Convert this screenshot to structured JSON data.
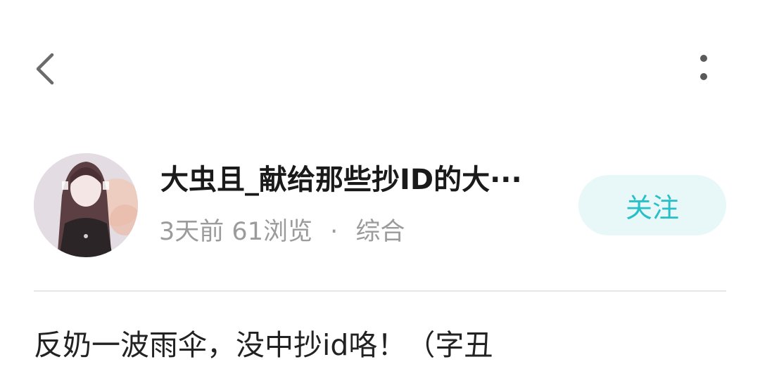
{
  "header": {
    "back_icon": "chevron-left-icon",
    "more_icon": "more-vertical-icon"
  },
  "post": {
    "author_title": "大虫且_献给那些抄ID的大···",
    "time": "3天前",
    "views": "61浏览",
    "separator": "·",
    "category": "综合",
    "follow_label": "关注",
    "body": "反奶一波雨伞，没中抄id咯！（字丑"
  },
  "colors": {
    "accent": "#28c0c8",
    "follow_bg": "#e8f7f7",
    "meta": "#9b9b9b",
    "divider": "#e6e6e6"
  }
}
